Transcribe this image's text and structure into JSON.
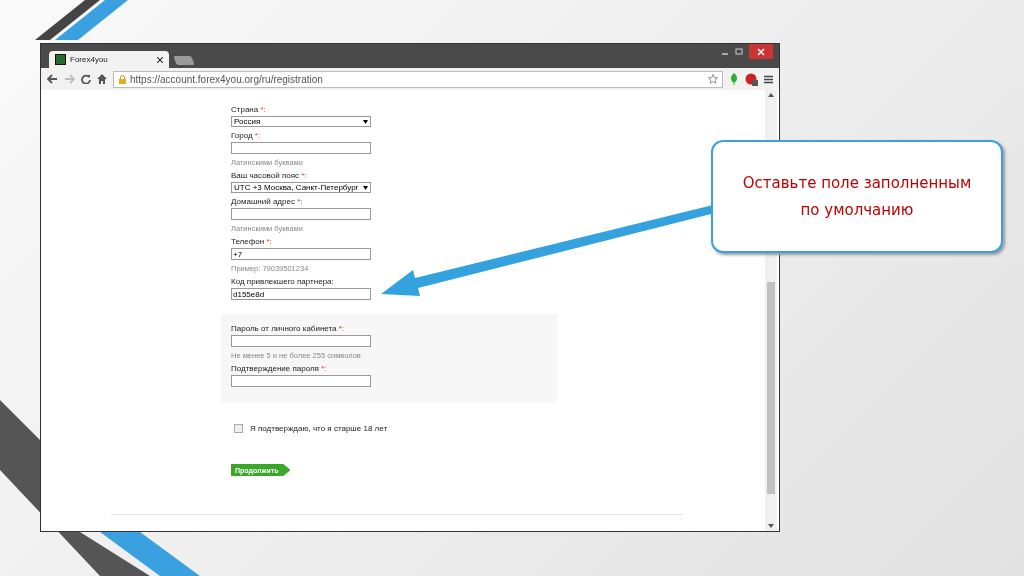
{
  "browser": {
    "tab_title": "Forex4you",
    "url": "https://account.forex4you.org/ru/registration"
  },
  "form": {
    "fields": [
      {
        "kind": "select",
        "label": "Страна",
        "mark": " *:",
        "value": "Россия"
      },
      {
        "kind": "text",
        "label": "Город",
        "mark": " *:",
        "hint": "Латинскими буквами"
      },
      {
        "kind": "select",
        "label": "Ваш часовой пояс",
        "mark": " *:",
        "value": "UTC +3 Москва, Санкт-Петербург"
      },
      {
        "kind": "text",
        "label": "Домашний адрес",
        "mark": " *:",
        "hint": "Латинскими буквами"
      },
      {
        "kind": "text",
        "label": "Телефон",
        "mark": " *:",
        "value": "+7",
        "hint": "Пример: 79039501234"
      },
      {
        "kind": "text",
        "label": "Код привлекшего партнера:",
        "value": "d155e8d"
      }
    ],
    "password_fields": [
      {
        "kind": "password",
        "label": "Пароль от личного кабинета",
        "mark": " *:",
        "hint": "Не менее 5 и не более 255 символов"
      },
      {
        "kind": "password",
        "label": "Подтверждение пароля",
        "mark": " *:"
      }
    ],
    "age_checkbox": {
      "label": "Я подтверждаю, что я старше 18 лет",
      "checked": false
    },
    "submit": "Продолжить"
  },
  "callout": {
    "text": "Оставьте поле заполненным по умолчанию"
  }
}
